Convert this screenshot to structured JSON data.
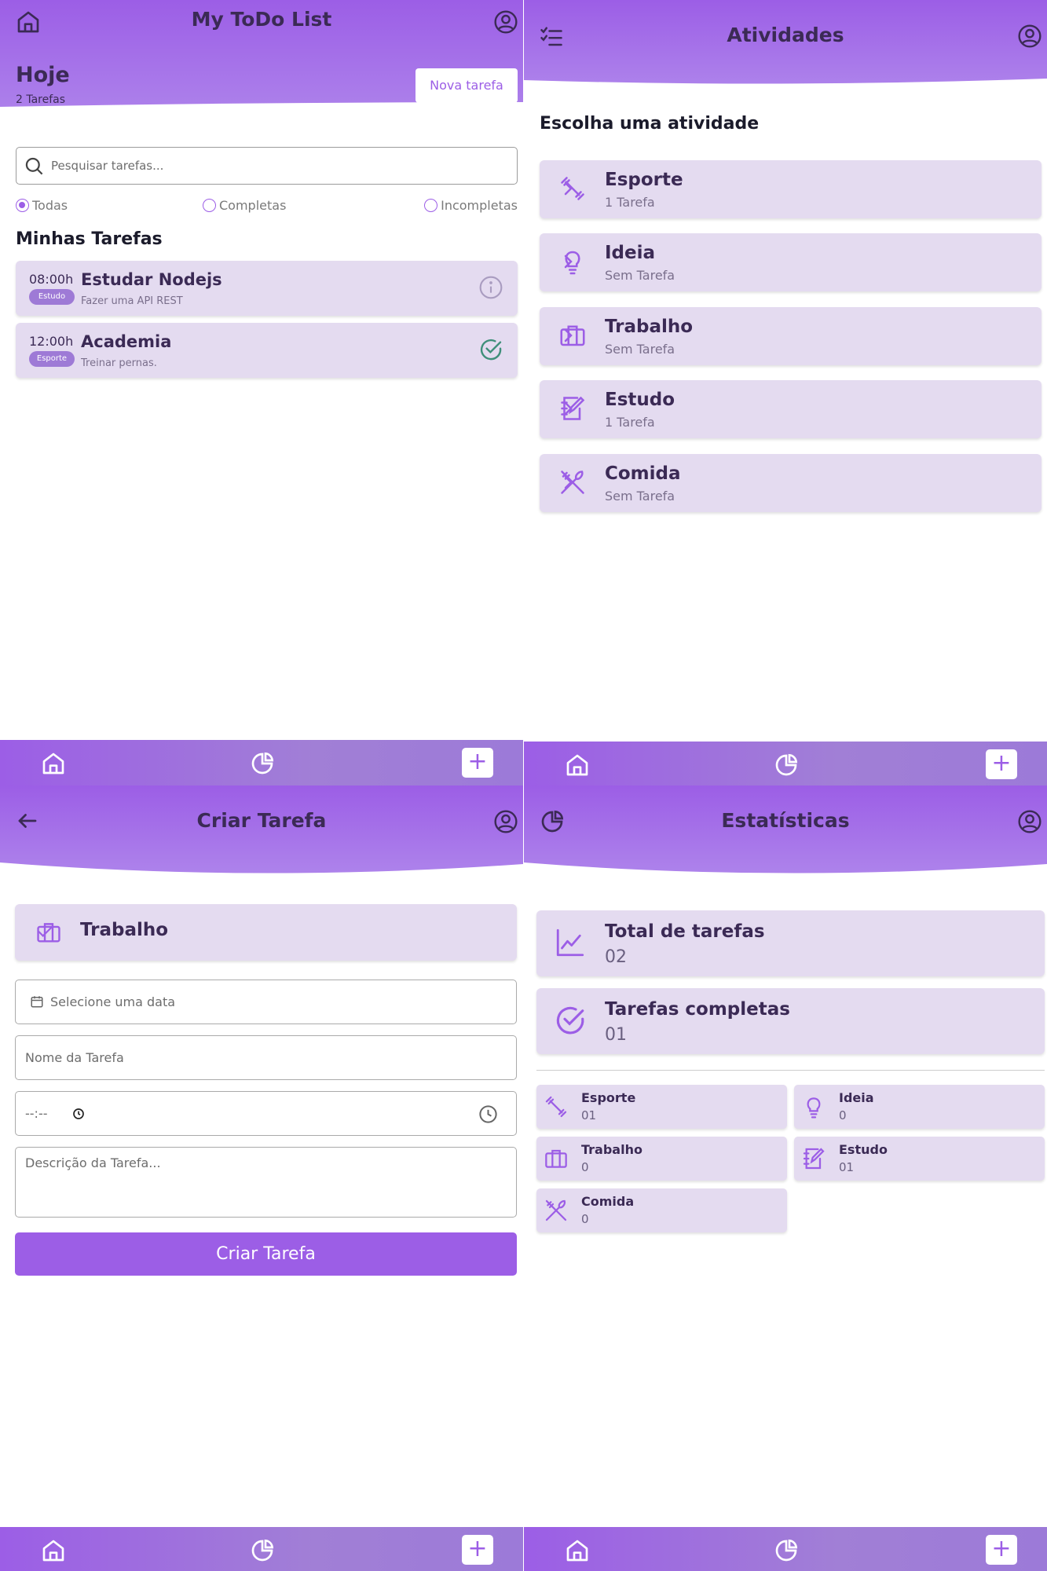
{
  "colors": {
    "accent": "#9c5ee6",
    "card": "#e4dbf0",
    "text": "#3b2a55"
  },
  "home": {
    "title": "My ToDo List",
    "today": "Hoje",
    "task_count": "2 Tarefas",
    "new_task_label": "Nova tarefa",
    "search_placeholder": "Pesquisar tarefas...",
    "filters": [
      {
        "label": "Todas",
        "selected": true
      },
      {
        "label": "Completas",
        "selected": false
      },
      {
        "label": "Incompletas",
        "selected": false
      }
    ],
    "section_title": "Minhas Tarefas",
    "tasks": [
      {
        "time": "08:00h",
        "tag": "Estudo",
        "name": "Estudar Nodejs",
        "description": "Fazer uma API REST",
        "status_icon": "info-icon"
      },
      {
        "time": "12:00h",
        "tag": "Esporte",
        "name": "Academia",
        "description": "Treinar pernas.",
        "status_icon": "check-circle-icon"
      }
    ]
  },
  "activities": {
    "title": "Atividades",
    "subtitle": "Escolha uma atividade",
    "items": [
      {
        "name": "Esporte",
        "count": "1 Tarefa",
        "icon": "dumbbell-icon"
      },
      {
        "name": "Ideia",
        "count": "Sem Tarefa",
        "icon": "lightbulb-icon"
      },
      {
        "name": "Trabalho",
        "count": "Sem Tarefa",
        "icon": "briefcase-icon"
      },
      {
        "name": "Estudo",
        "count": "1 Tarefa",
        "icon": "notebook-icon"
      },
      {
        "name": "Comida",
        "count": "Sem Tarefa",
        "icon": "utensils-icon"
      }
    ]
  },
  "create": {
    "title": "Criar Tarefa",
    "selected_category": "Trabalho",
    "date_placeholder": "Selecione uma data",
    "name_placeholder": "Nome da Tarefa",
    "time_placeholder": "--:--",
    "description_placeholder": "Descrição da Tarefa...",
    "submit_label": "Criar Tarefa"
  },
  "stats": {
    "title": "Estatísticas",
    "total_label": "Total de tarefas",
    "total_value": "02",
    "completed_label": "Tarefas completas",
    "completed_value": "01",
    "categories": [
      {
        "name": "Esporte",
        "value": "01",
        "icon": "dumbbell-icon"
      },
      {
        "name": "Ideia",
        "value": "0",
        "icon": "lightbulb-icon"
      },
      {
        "name": "Trabalho",
        "value": "0",
        "icon": "briefcase-icon"
      },
      {
        "name": "Estudo",
        "value": "01",
        "icon": "notebook-icon"
      },
      {
        "name": "Comida",
        "value": "0",
        "icon": "utensils-icon"
      }
    ]
  },
  "nav": {
    "add_label": "+"
  }
}
